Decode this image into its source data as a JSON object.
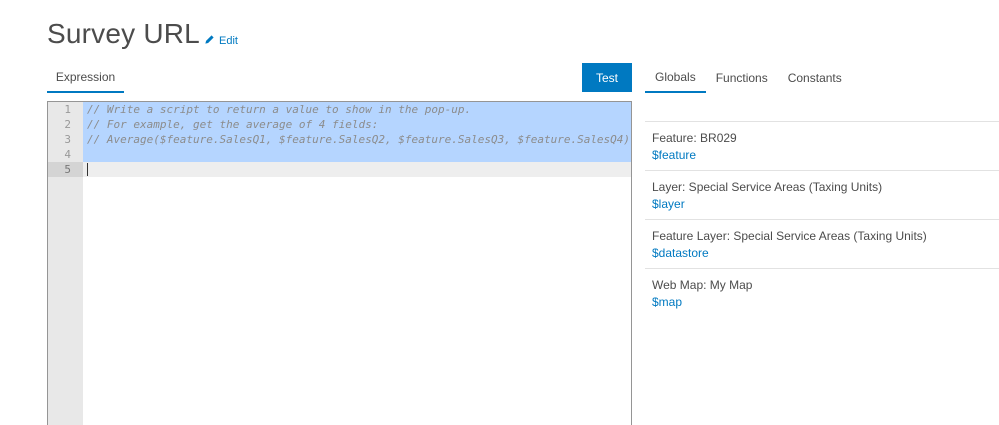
{
  "header": {
    "title": "Survey URL",
    "edit_label": "Edit"
  },
  "left_tab": {
    "label": "Expression"
  },
  "test_button": {
    "label": "Test"
  },
  "editor": {
    "line_numbers": [
      "1",
      "2",
      "3",
      "4",
      "5"
    ],
    "lines": [
      "// Write a script to return a value to show in the pop-up.",
      "// For example, get the average of 4 fields:",
      "// Average($feature.SalesQ1, $feature.SalesQ2, $feature.SalesQ3, $feature.SalesQ4)",
      "",
      ""
    ]
  },
  "right_tabs": [
    {
      "label": "Globals",
      "active": true
    },
    {
      "label": "Functions",
      "active": false
    },
    {
      "label": "Constants",
      "active": false
    }
  ],
  "globals": [
    {
      "label": "Feature: BR029",
      "variable": "$feature"
    },
    {
      "label": "Layer: Special Service Areas (Taxing Units)",
      "variable": "$layer"
    },
    {
      "label": "Feature Layer: Special Service Areas (Taxing Units)",
      "variable": "$datastore"
    },
    {
      "label": "Web Map: My Map",
      "variable": "$map"
    }
  ],
  "colors": {
    "accent": "#0079c1",
    "selection": "#b5d5ff",
    "gutter": "#e8e8e8"
  }
}
